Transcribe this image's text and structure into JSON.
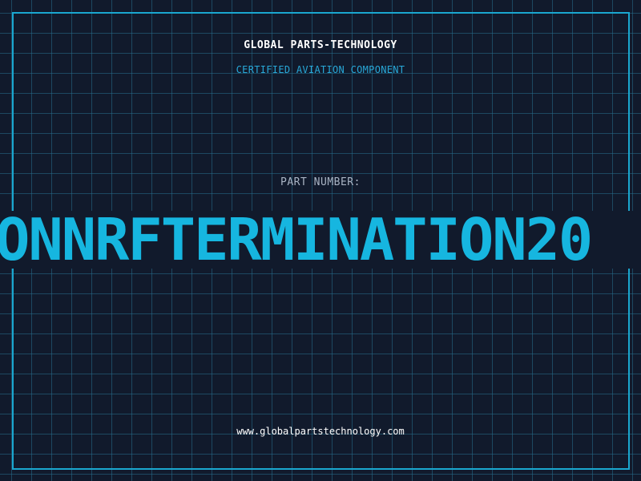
{
  "header": {
    "company_name": "GLOBAL PARTS-TECHNOLOGY",
    "subtitle": "CERTIFIED AVIATION COMPONENT"
  },
  "part": {
    "label": "PART NUMBER:",
    "number": "ONNRFTERMINATION20"
  },
  "footer": {
    "website": "www.globalpartstechnology.com"
  },
  "colors": {
    "background": "#111a2c",
    "grid": "#266e8c",
    "accent": "#1aa7cf",
    "part_number": "#16b6e0"
  }
}
